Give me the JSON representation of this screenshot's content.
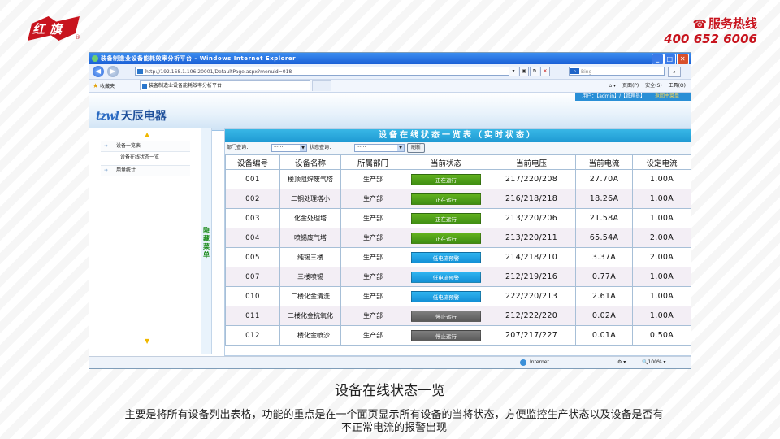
{
  "brand": {
    "logo_text": "红旗",
    "reg_mark": "®",
    "color": "#c8141e"
  },
  "hotline": {
    "label": "服务热线",
    "number": "400 652 6006",
    "color": "#c8141e"
  },
  "browser": {
    "window_title": "装备制造业设备能耗效率分析平台 - Windows Internet Explorer",
    "address": "http://192.168.1.106:20001/DefaultPage.aspx?menuid=018",
    "search_placeholder": "Bing",
    "favorites_label": "收藏夹",
    "tab_title": "装备制造业设备能耗效率分析平台",
    "tools": {
      "page": "页面(P)",
      "safety": "安全(S)",
      "tools": "工具(O)"
    },
    "status_zone": "Internet",
    "zoom": "100%"
  },
  "app": {
    "logo_en": "tzwl",
    "logo_cn": "天辰电器",
    "user_info": "用户：【admin】/【管理员】",
    "return_link": "返回主菜单"
  },
  "sidebar": {
    "items": [
      {
        "label": "设备一览表"
      },
      {
        "label": "用量统计"
      }
    ],
    "sub_items": [
      {
        "label": "设备在线状态一览"
      }
    ],
    "hide_menu_label": "隐藏菜单"
  },
  "main": {
    "title": "设备在线状态一览表（实时状态）",
    "filters": {
      "dept_label": "部门查询：",
      "dept_value": "······",
      "status_label": "状态查询：",
      "status_value": "······",
      "refresh_label": "刷新"
    },
    "columns": [
      "设备编号",
      "设备名称",
      "所属部门",
      "当前状态",
      "当前电压",
      "当前电流",
      "设定电流"
    ],
    "rows": [
      {
        "code": "001",
        "name": "楼顶阻焊废气塔",
        "dept": "生产部",
        "status": "正在运行",
        "status_type": "run",
        "voltage": "217/220/208",
        "current": "27.70A",
        "set_current": "1.00A"
      },
      {
        "code": "002",
        "name": "二铜处理塔小",
        "dept": "生产部",
        "status": "正在运行",
        "status_type": "run",
        "voltage": "216/218/218",
        "current": "18.26A",
        "set_current": "1.00A"
      },
      {
        "code": "003",
        "name": "化金处理塔",
        "dept": "生产部",
        "status": "正在运行",
        "status_type": "run",
        "voltage": "213/220/206",
        "current": "21.58A",
        "set_current": "1.00A"
      },
      {
        "code": "004",
        "name": "喷锡废气塔",
        "dept": "生产部",
        "status": "正在运行",
        "status_type": "run",
        "voltage": "213/220/211",
        "current": "65.54A",
        "set_current": "2.00A"
      },
      {
        "code": "005",
        "name": "纯锡三楼",
        "dept": "生产部",
        "status": "低电流预警",
        "status_type": "low",
        "voltage": "214/218/210",
        "current": "3.37A",
        "set_current": "2.00A"
      },
      {
        "code": "007",
        "name": "三楼喷锡",
        "dept": "生产部",
        "status": "低电流预警",
        "status_type": "low",
        "voltage": "212/219/216",
        "current": "0.77A",
        "set_current": "1.00A"
      },
      {
        "code": "010",
        "name": "二楼化金清洗",
        "dept": "生产部",
        "status": "低电流预警",
        "status_type": "low",
        "voltage": "222/220/213",
        "current": "2.61A",
        "set_current": "1.00A"
      },
      {
        "code": "011",
        "name": "二楼化金抗氧化",
        "dept": "生产部",
        "status": "停止运行",
        "status_type": "stop",
        "voltage": "212/222/220",
        "current": "0.02A",
        "set_current": "1.00A"
      },
      {
        "code": "012",
        "name": "二楼化金喷沙",
        "dept": "生产部",
        "status": "停止运行",
        "status_type": "stop",
        "voltage": "207/217/227",
        "current": "0.01A",
        "set_current": "0.50A"
      }
    ],
    "status_colors": {
      "run": "#4f9e18",
      "low": "#1c9fe0",
      "stop": "#6a6a6a"
    }
  },
  "caption": {
    "title": "设备在线状态一览",
    "description": "主要是将所有设备列出表格，功能的重点是在一个面页显示所有设备的当将状态，方便监控生产状态以及设备是否有不正常电流的报警出现"
  }
}
